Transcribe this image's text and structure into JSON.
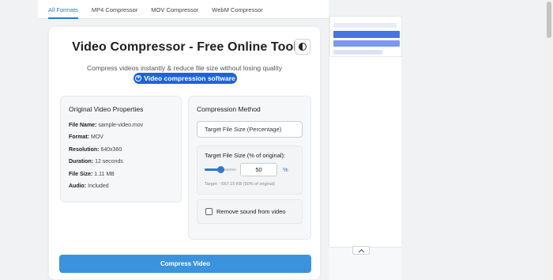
{
  "tabs": [
    {
      "label": "All Formats",
      "active": true
    },
    {
      "label": "MP4 Compressor",
      "active": false
    },
    {
      "label": "MOV Compressor",
      "active": false
    },
    {
      "label": "WebM Compressor",
      "active": false
    }
  ],
  "header": {
    "title": "Video Compressor - Free Online Tool",
    "subtitle": "Compress videos instantly & reduce file size without losing quality",
    "badge_label": "Video compression software",
    "theme_toggle_icon": "contrast-icon"
  },
  "properties": {
    "heading": "Original Video Properties",
    "items": [
      {
        "label": "File Name:",
        "value": "sample-video.mov"
      },
      {
        "label": "Format:",
        "value": "MOV"
      },
      {
        "label": "Resolution:",
        "value": "640x360"
      },
      {
        "label": "Duration:",
        "value": "12 seconds"
      },
      {
        "label": "File Size:",
        "value": "1.11 MB"
      },
      {
        "label": "Audio:",
        "value": "Included"
      }
    ]
  },
  "compression": {
    "heading": "Compression Method",
    "method_selected": "Target File Size (Percentage)",
    "target_label": "Target File Size (% of original):",
    "slider_value_fraction": 0.5,
    "percent_value": "50",
    "percent_unit": "%",
    "target_hint": "Target: ~567.15 KB (50% of original)",
    "remove_sound_label": "Remove sound from video",
    "remove_sound_checked": false
  },
  "actions": {
    "compress_label": "Compress Video"
  },
  "colors": {
    "accent": "#2b7ad3",
    "badge": "#1d64d8",
    "button": "#3a93dc"
  }
}
